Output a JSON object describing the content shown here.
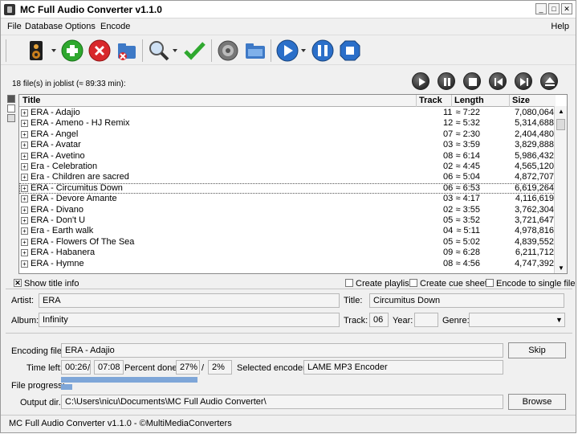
{
  "window": {
    "title": "MC Full Audio Converter v1.1.0"
  },
  "menu": [
    "File",
    "Database",
    "Options",
    "Encode"
  ],
  "menu_help": "Help",
  "toolbar_icons": [
    "speaker-icon",
    "add-icon",
    "remove-icon",
    "database-icon",
    "search-icon",
    "check-icon",
    "settings-icon",
    "folder-icon",
    "play-icon",
    "pause-icon",
    "stop-icon"
  ],
  "joblist_info": "18 file(s) in joblist (≈ 89:33 min):",
  "table": {
    "headers": {
      "title": "Title",
      "track": "Track",
      "length": "Length",
      "size": "Size"
    },
    "rows": [
      {
        "title": "ERA - Adajio",
        "track": "11",
        "length": "≈ 7:22",
        "size": "7,080,064"
      },
      {
        "title": "ERA - Ameno - HJ Remix",
        "track": "12",
        "length": "≈ 5:32",
        "size": "5,314,688"
      },
      {
        "title": "ERA - Angel",
        "track": "07",
        "length": "≈ 2:30",
        "size": "2,404,480"
      },
      {
        "title": "ERA - Avatar",
        "track": "03",
        "length": "≈ 3:59",
        "size": "3,829,888"
      },
      {
        "title": "ERA - Avetino",
        "track": "08",
        "length": "≈ 6:14",
        "size": "5,986,432"
      },
      {
        "title": "Era - Celebration",
        "track": "02",
        "length": "≈ 4:45",
        "size": "4,565,120"
      },
      {
        "title": "Era - Children are sacred",
        "track": "06",
        "length": "≈ 5:04",
        "size": "4,872,707"
      },
      {
        "title": "ERA - Circumitus Down",
        "track": "06",
        "length": "≈ 6:53",
        "size": "6,619,264"
      },
      {
        "title": "ERA - Devore Amante",
        "track": "03",
        "length": "≈ 4:17",
        "size": "4,116,619"
      },
      {
        "title": "ERA - Divano",
        "track": "02",
        "length": "≈ 3:55",
        "size": "3,762,304"
      },
      {
        "title": "ERA - Don't U",
        "track": "05",
        "length": "≈ 3:52",
        "size": "3,721,647"
      },
      {
        "title": "Era - Earth walk",
        "track": "04",
        "length": "≈ 5:11",
        "size": "4,978,816"
      },
      {
        "title": "ERA - Flowers Of The Sea",
        "track": "05",
        "length": "≈ 5:02",
        "size": "4,839,552"
      },
      {
        "title": "ERA - Habanera",
        "track": "09",
        "length": "≈ 6:28",
        "size": "6,211,712"
      },
      {
        "title": "ERA - Hymne",
        "track": "08",
        "length": "≈ 4:56",
        "size": "4,747,392"
      }
    ]
  },
  "options": {
    "show_title_info": "Show title info",
    "create_playlist": "Create playlist",
    "create_cue_sheet": "Create cue sheet",
    "encode_single": "Encode to single file"
  },
  "info": {
    "artist_label": "Artist:",
    "artist": "ERA",
    "title_label": "Title:",
    "title": "Circumitus Down",
    "album_label": "Album:",
    "album": "Infinity",
    "track_label": "Track:",
    "track": "06",
    "year_label": "Year:",
    "year": "",
    "genre_label": "Genre:",
    "genre": ""
  },
  "encoding": {
    "file_label": "Encoding file:",
    "file": "ERA - Adajio",
    "skip": "Skip",
    "time_left_label": "Time left:",
    "time_left": "00:26",
    "slash1": "/",
    "time_total": "07:08",
    "percent_label": "Percent done:",
    "percent_file": "27%",
    "slash2": "/",
    "percent_total": "2%",
    "encoder_label": "Selected encoder:",
    "encoder": "LAME MP3 Encoder",
    "progress_label": "File progress:",
    "file_progress": 0.27,
    "total_progress": 0.02,
    "output_label": "Output dir.:",
    "output": "C:\\Users\\nicu\\Documents\\MC Full Audio Converter\\",
    "browse": "Browse"
  },
  "status": "MC Full Audio Converter v1.1.0 - ©MultiMediaConverters",
  "colors": {
    "green": "#2fa82f",
    "red": "#d8282b",
    "blue": "#2b6fc9",
    "progress": "#7ea6d8"
  }
}
